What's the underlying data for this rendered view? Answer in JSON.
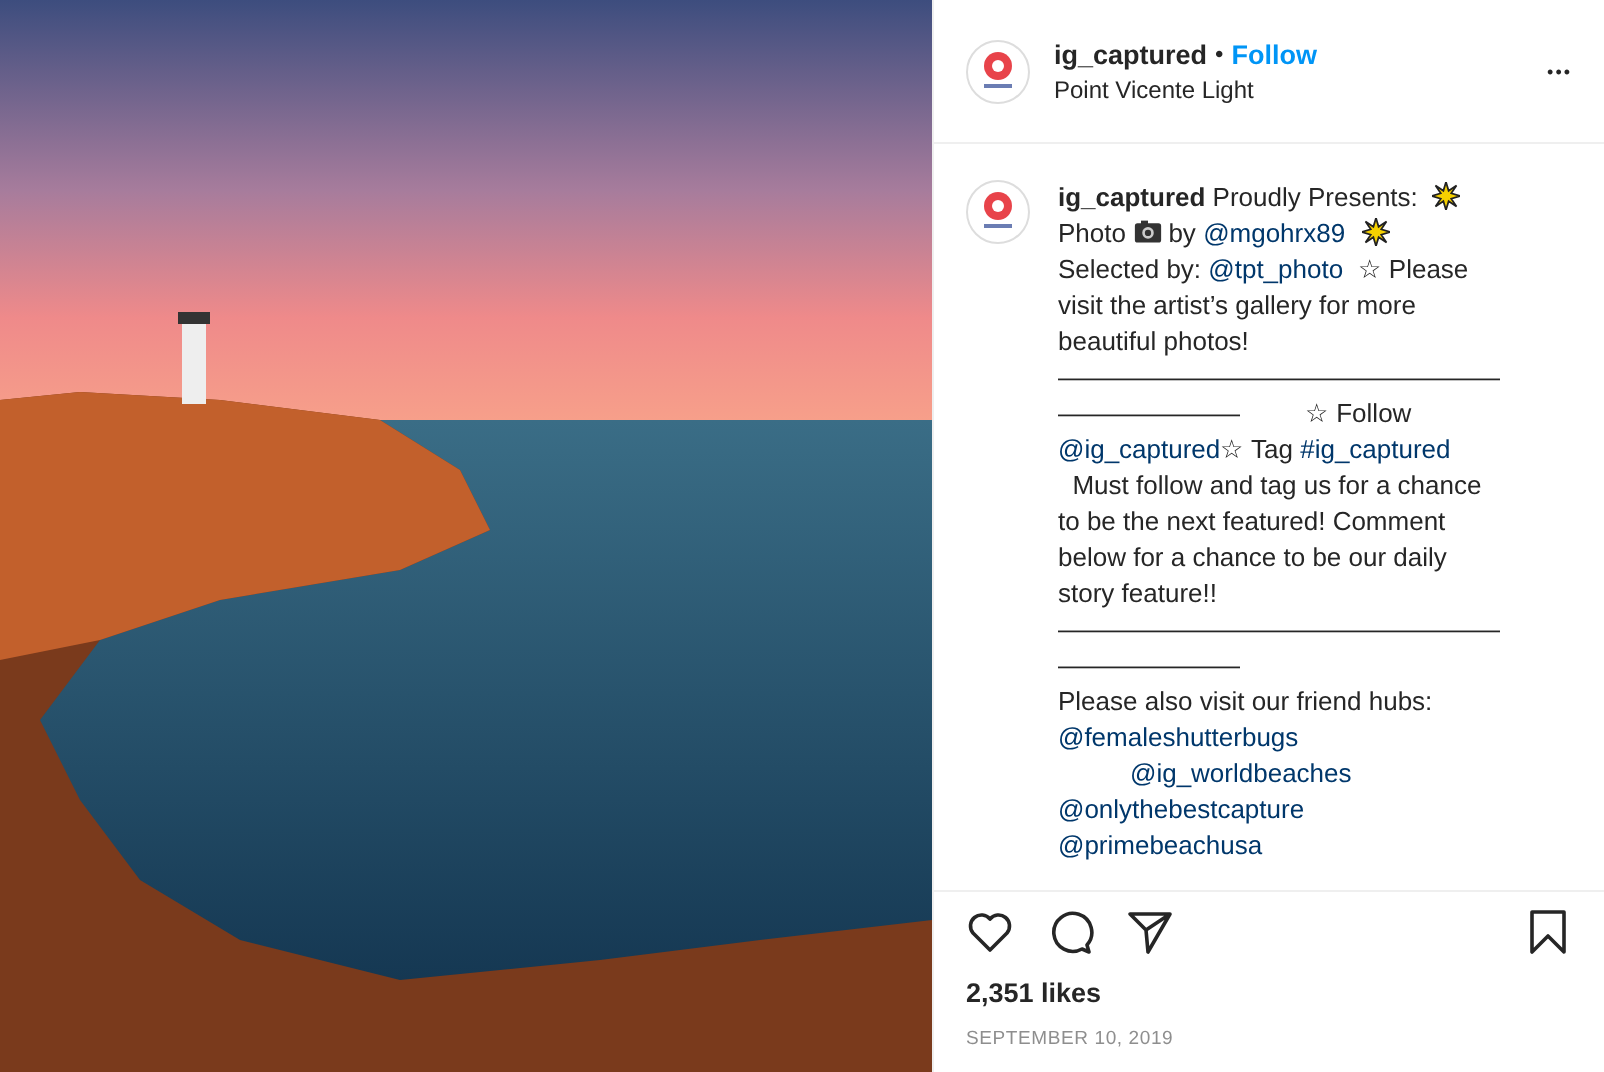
{
  "header": {
    "username": "ig_captured",
    "separator": "•",
    "follow": "Follow",
    "location": "Point Vicente Light",
    "more": "•••"
  },
  "caption": {
    "lines": [
      [
        {
          "kind": "bold",
          "text": "ig_captured"
        },
        {
          "kind": "text",
          "text": " Proudly Presents:  "
        },
        {
          "kind": "burst"
        }
      ],
      [
        {
          "kind": "text",
          "text": "Photo "
        },
        {
          "kind": "camera"
        },
        {
          "kind": "text",
          "text": " by "
        },
        {
          "kind": "link",
          "text": "@mgohrx89"
        },
        {
          "kind": "space"
        },
        {
          "kind": "burst"
        }
      ],
      [
        {
          "kind": "text",
          "text": "Selected by: "
        },
        {
          "kind": "link",
          "text": "@tpt_photo"
        },
        {
          "kind": "text",
          "text": "  ☆ Please"
        }
      ],
      [
        {
          "kind": "text",
          "text": "visit the artist’s gallery for more"
        }
      ],
      [
        {
          "kind": "text",
          "text": "beautiful photos!"
        }
      ],
      [
        {
          "kind": "text",
          "text": "—————————————————"
        }
      ],
      [
        {
          "kind": "text",
          "text": "———————         ☆ Follow"
        }
      ],
      [
        {
          "kind": "link",
          "text": "@ig_captured"
        },
        {
          "kind": "text",
          "text": "☆ Tag "
        },
        {
          "kind": "link",
          "text": "#ig_captured"
        }
      ],
      [
        {
          "kind": "text",
          "text": "  Must follow and tag us for a chance"
        }
      ],
      [
        {
          "kind": "text",
          "text": "to be the next featured! Comment"
        }
      ],
      [
        {
          "kind": "text",
          "text": "below for a chance to be our daily"
        }
      ],
      [
        {
          "kind": "text",
          "text": "story feature!!"
        }
      ],
      [
        {
          "kind": "text",
          "text": "—————————————————"
        }
      ],
      [
        {
          "kind": "text",
          "text": "———————"
        }
      ],
      [
        {
          "kind": "text",
          "text": "Please also visit our friend hubs:"
        }
      ],
      [
        {
          "kind": "link",
          "text": "@femaleshutterbugs"
        }
      ],
      [
        {
          "kind": "indent"
        },
        {
          "kind": "link",
          "text": "@ig_worldbeaches"
        }
      ],
      [
        {
          "kind": "link",
          "text": "@onlythebestcapture"
        }
      ],
      [
        {
          "kind": "link",
          "text": "@primebeachusa"
        }
      ]
    ]
  },
  "likes": "2,351 likes",
  "date": "SEPTEMBER 10, 2019"
}
